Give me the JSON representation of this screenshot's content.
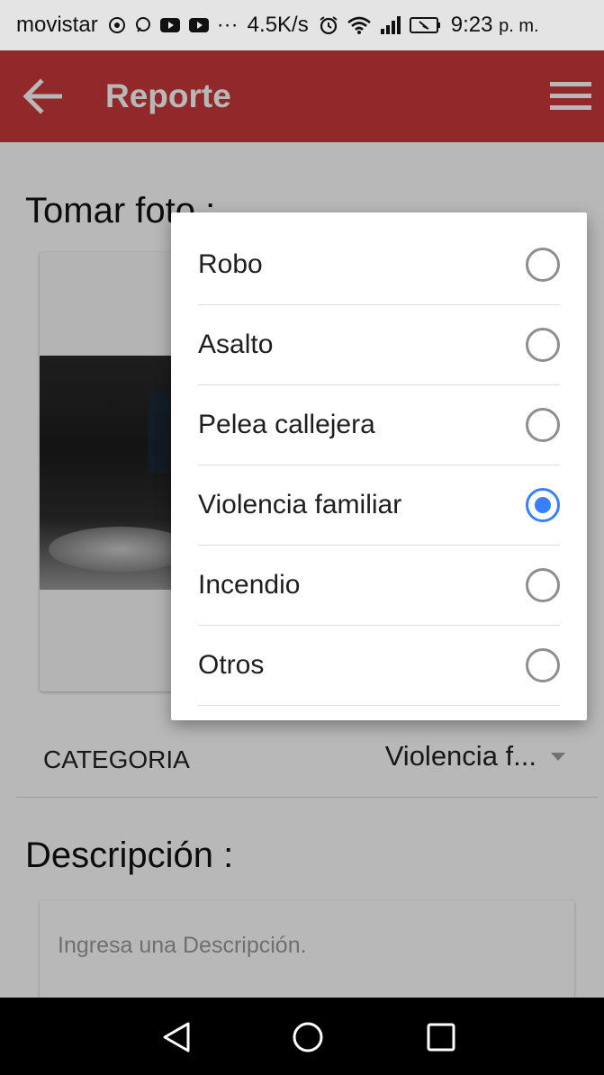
{
  "status_bar": {
    "carrier": "movistar",
    "more": "···",
    "speed": "4.5K/s",
    "time": "9:23",
    "ampm": "p. m."
  },
  "app_bar": {
    "title": "Reporte",
    "color": "#c9383a"
  },
  "page": {
    "photo_heading": "Tomar foto :",
    "category": {
      "label": "CATEGORIA",
      "value": "Violencia f..."
    },
    "description": {
      "heading": "Descripción :",
      "placeholder": "Ingresa una Descripción."
    }
  },
  "category_dialog": {
    "options": [
      {
        "label": "Robo",
        "selected": false
      },
      {
        "label": "Asalto",
        "selected": false
      },
      {
        "label": "Pelea callejera",
        "selected": false
      },
      {
        "label": "Violencia familiar",
        "selected": true
      },
      {
        "label": "Incendio",
        "selected": false
      },
      {
        "label": "Otros",
        "selected": false
      }
    ],
    "selected_color": "#3880ff"
  },
  "nav_bar": {
    "icons": [
      "back-triangle-icon",
      "home-circle-icon",
      "recents-square-icon"
    ]
  }
}
